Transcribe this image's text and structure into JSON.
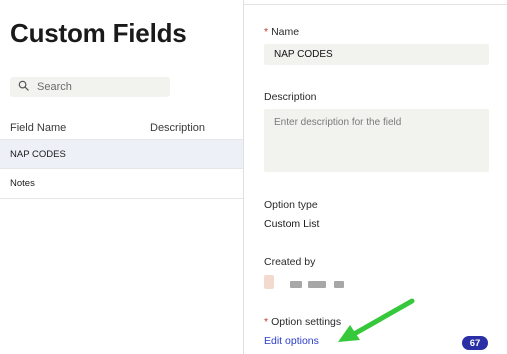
{
  "left": {
    "title": "Custom Fields",
    "search": {
      "placeholder": "Search",
      "value": ""
    },
    "columns": [
      "Field Name",
      "Description"
    ],
    "rows": [
      {
        "name": "NAP CODES",
        "selected": true
      },
      {
        "name": "Notes",
        "selected": false
      }
    ]
  },
  "detail": {
    "name_label": "Name",
    "name_value": "NAP CODES",
    "description_label": "Description",
    "description_placeholder": "Enter description for the field",
    "option_type_label": "Option type",
    "option_type_value": "Custom List",
    "created_by_label": "Created by",
    "option_settings_label": "Option settings",
    "edit_options_link": "Edit options",
    "badge_count": "67"
  },
  "icons": {
    "search": "search-icon",
    "arrow": "green-arrow-icon"
  },
  "colors": {
    "selected_row": "#eef0f8",
    "link": "#2a3ec9",
    "badge": "#2b2fa6",
    "required": "#c0392b",
    "arrow": "#35c83a"
  }
}
